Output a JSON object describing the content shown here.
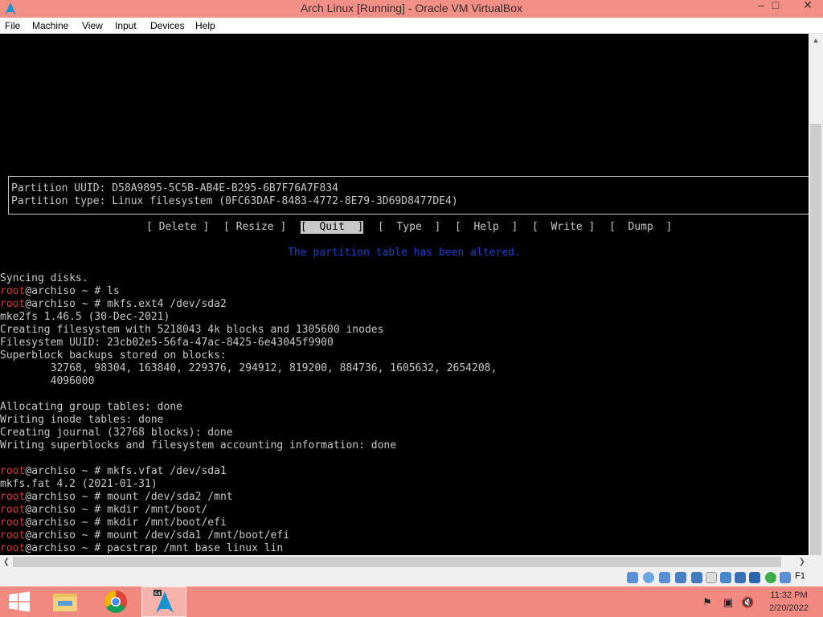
{
  "window": {
    "title": "Arch Linux [Running] - Oracle VM VirtualBox",
    "minimize": "–",
    "maximize": "□",
    "close": "✕"
  },
  "menu": [
    "File",
    "Machine",
    "View",
    "Input",
    "Devices",
    "Help"
  ],
  "terminal": {
    "box_lines": [
      "Partition UUID: D58A9895-5C5B-AB4E-B295-6B7F76A7F834",
      "Partition type: Linux filesystem (0FC63DAF-8483-4772-8E79-3D69D8477DE4)"
    ],
    "fdisk_menu": [
      "[ Delete ]",
      "[ Resize ]",
      "[  Quit  ]",
      "[  Type  ]",
      "[  Help  ]",
      "[  Write ]",
      "[  Dump  ]"
    ],
    "fdisk_selected": "[  Quit  ]",
    "status_message": "The partition table has been altered.",
    "prompt_user": "root",
    "prompt_rest": "@archiso ~ # ",
    "lines": [
      {
        "text": "Syncing disks."
      },
      {
        "cmd": "ls"
      },
      {
        "cmd": "mkfs.ext4 /dev/sda2"
      },
      {
        "text": "mke2fs 1.46.5 (30-Dec-2021)"
      },
      {
        "text": "Creating filesystem with 5218043 4k blocks and 1305600 inodes"
      },
      {
        "text": "Filesystem UUID: 23cb02e5-56fa-47ac-8425-6e43045f9900"
      },
      {
        "text": "Superblock backups stored on blocks:"
      },
      {
        "text": "        32768, 98304, 163840, 229376, 294912, 819200, 884736, 1605632, 2654208,"
      },
      {
        "text": "        4096000"
      },
      {
        "text": ""
      },
      {
        "text": "Allocating group tables: done"
      },
      {
        "text": "Writing inode tables: done"
      },
      {
        "text": "Creating journal (32768 blocks): done"
      },
      {
        "text": "Writing superblocks and filesystem accounting information: done"
      },
      {
        "text": ""
      },
      {
        "cmd": "mkfs.vfat /dev/sda1"
      },
      {
        "text": "mkfs.fat 4.2 (2021-01-31)"
      },
      {
        "cmd": "mount /dev/sda2 /mnt"
      },
      {
        "cmd": "mkdir /mnt/boot/"
      },
      {
        "cmd": "mkdir /mnt/boot/efi"
      },
      {
        "cmd": "mount /dev/sda1 /mnt/boot/efi"
      },
      {
        "cmd": "pacstrap /mnt base linux lin"
      }
    ]
  },
  "statusbar": {
    "host_key": "F1",
    "icon_names": [
      "hard-disk-icon",
      "optical-disk-icon",
      "audio-icon",
      "network-icon",
      "usb-icon",
      "shared-folder-icon",
      "display-icon",
      "recording-icon",
      "vt-x-icon",
      "mouse-integration-icon",
      "keyboard-icon"
    ]
  },
  "taskbar": {
    "apps": [
      "file-explorer-icon",
      "chrome-icon",
      "virtualbox-icon"
    ],
    "time": "11:32 PM",
    "date": "2/20/2022",
    "tray": [
      "action-center-flag-icon",
      "network-icon",
      "volume-muted-icon"
    ]
  },
  "colors": {
    "titlebar": "#f28f86",
    "terminal_bg": "#000000",
    "terminal_fg": "#c8c8c8",
    "prompt_user": "#e03a3a",
    "altered_msg": "#1f3fd0"
  }
}
